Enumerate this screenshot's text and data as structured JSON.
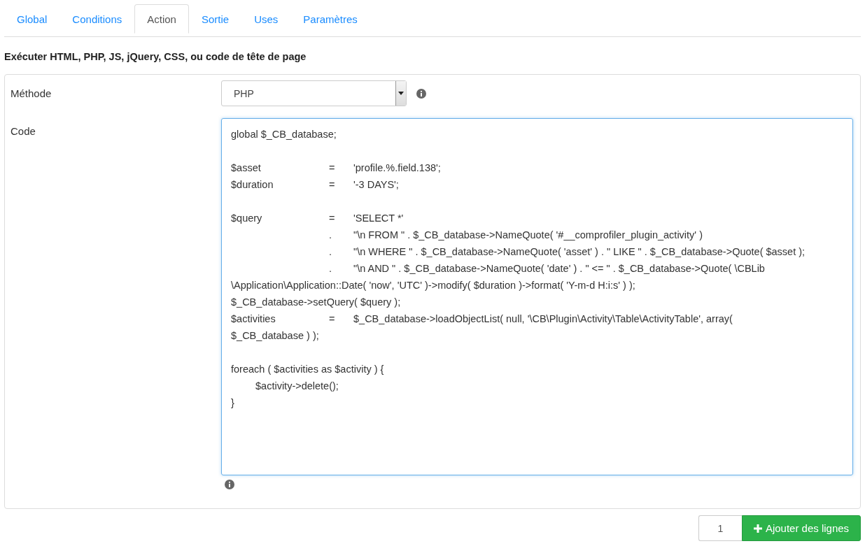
{
  "tabs": [
    {
      "label": "Global",
      "selected": false
    },
    {
      "label": "Conditions",
      "selected": false
    },
    {
      "label": "Action",
      "selected": true
    },
    {
      "label": "Sortie",
      "selected": false
    },
    {
      "label": "Uses",
      "selected": false
    },
    {
      "label": "Paramètres",
      "selected": false
    }
  ],
  "heading": "Exécuter HTML, PHP, JS, jQuery, CSS, ou code de tête de page",
  "form": {
    "method": {
      "label": "Méthode",
      "value": "PHP"
    },
    "code": {
      "label": "Code",
      "blocks": [
        [
          "global $_CB_database;"
        ],
        [
          "$asset\t\t\t=\t'profile.%.field.138';",
          "$duration\t\t\t=\t'-3 DAYS';"
        ],
        [
          "$query\t\t\t=\t'SELECT *'",
          "\t\t\t\t.\t\"\\n FROM \" . $_CB_database->NameQuote( '#__comprofiler_plugin_activity' )",
          "\t\t\t\t.\t\"\\n WHERE \" . $_CB_database->NameQuote( 'asset' ) . \" LIKE \" . $_CB_database->Quote( $asset );",
          "\t\t\t\t.\t\"\\n AND \" . $_CB_database->NameQuote( 'date' ) . \" <= \" . $_CB_database->Quote( \\CBLib",
          "\\Application\\Application::Date( 'now', 'UTC' )->modify( $duration )->format( 'Y-m-d H:i:s' ) );",
          "$_CB_database->setQuery( $query );",
          "$activities\t\t\t=\t$_CB_database->loadObjectList( null, '\\CB\\Plugin\\Activity\\Table\\ActivityTable', array(",
          "$_CB_database ) );"
        ],
        [
          "foreach ( $activities as $activity ) {",
          "\t$activity->delete();",
          "}"
        ]
      ]
    }
  },
  "footer": {
    "count": "1",
    "button": "Ajouter des lignes"
  }
}
